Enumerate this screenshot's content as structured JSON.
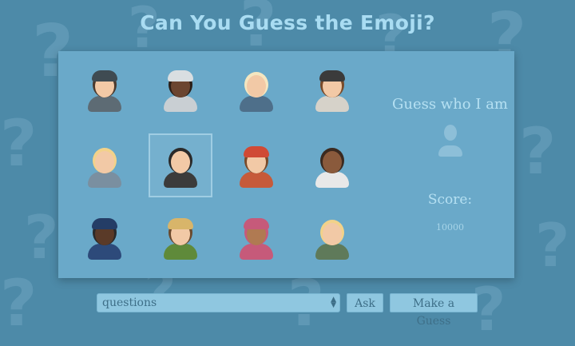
{
  "title": "Can You Guess the Emoji?",
  "side": {
    "prompt": "Guess who I am",
    "score_label": "Score:",
    "score_value": "10000"
  },
  "controls": {
    "select_value": "questions",
    "ask_label": "Ask",
    "guess_label": "Make a Guess"
  },
  "characters": [
    {
      "name": "woman-detective",
      "skin": "#f2c9a6",
      "hair": "#4a3a2e",
      "outfit": "#5d6b74",
      "hat": "#3f4b52"
    },
    {
      "name": "astronaut",
      "skin": "#6b4530",
      "hair": "#2b1f18",
      "outfit": "#c9cfd3",
      "hat": "#d9dee1"
    },
    {
      "name": "person-mechanic",
      "skin": "#f2c9a6",
      "hair": "#f4e6c0",
      "outfit": "#4e6f8a",
      "hat": ""
    },
    {
      "name": "man-artist",
      "skin": "#f2c9a6",
      "hair": "#7a4b2a",
      "outfit": "#d6d2c9",
      "hat": "#3b3b3b"
    },
    {
      "name": "woman-blonde",
      "skin": "#f2c9a6",
      "hair": "#f2d28a",
      "outfit": "#7a8fa0",
      "hat": ""
    },
    {
      "name": "vampire",
      "skin": "#f2c9a6",
      "hair": "#2a2a2a",
      "outfit": "#3b3b3b",
      "hat": ""
    },
    {
      "name": "firefighter",
      "skin": "#f2c9a6",
      "hair": "#7a4b2a",
      "outfit": "#c65a3a",
      "hat": "#d04a35"
    },
    {
      "name": "woman-scientist",
      "skin": "#8a5a3c",
      "hair": "#3b2a20",
      "outfit": "#e8e8e8",
      "hat": ""
    },
    {
      "name": "police-officer",
      "skin": "#5a3a28",
      "hair": "#2a2a2a",
      "outfit": "#2d4a7a",
      "hat": "#243d66"
    },
    {
      "name": "woman-farmer",
      "skin": "#f2c9a6",
      "hair": "#6b4a2e",
      "outfit": "#5f8a3a",
      "hat": "#d8b56a"
    },
    {
      "name": "woman-headscarf",
      "skin": "#b07a52",
      "hair": "#c65a7a",
      "outfit": "#c65a7a",
      "hat": "#c65a7a"
    },
    {
      "name": "man-teacher",
      "skin": "#f2c9a6",
      "hair": "#f2d28a",
      "outfit": "#5f7a5a",
      "hat": ""
    }
  ]
}
